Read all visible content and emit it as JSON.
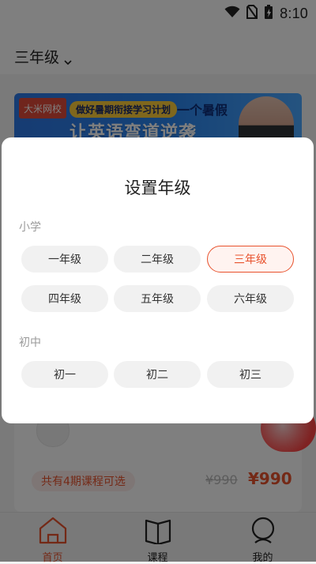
{
  "status_bar": {
    "time": "8:10",
    "icons": [
      "wifi-icon",
      "no-sim-icon",
      "battery-charging-icon"
    ]
  },
  "header": {
    "grade_label": "三年级",
    "dropdown_icon": "chevron-down-icon"
  },
  "banner": {
    "logo_text": "大米网校",
    "tag_text": "做好暑期衔接学习计划",
    "right_text": "一个暑假",
    "title_text": "让英语弯道逆袭"
  },
  "course_card": {
    "periods_text": "共有4期课程可选",
    "price_original": "¥990",
    "price_current": "¥990"
  },
  "dialog": {
    "title": "设置年级",
    "sections": [
      {
        "label": "小学",
        "options": [
          "一年级",
          "二年级",
          "三年级",
          "四年级",
          "五年级",
          "六年级"
        ]
      },
      {
        "label": "初中",
        "options": [
          "初一",
          "初二",
          "初三"
        ]
      }
    ],
    "selected": "三年级"
  },
  "tabbar": {
    "items": [
      {
        "label": "首页",
        "icon": "home-icon",
        "active": true
      },
      {
        "label": "课程",
        "icon": "book-icon",
        "active": false
      },
      {
        "label": "我的",
        "icon": "profile-icon",
        "active": false
      }
    ]
  },
  "colors": {
    "accent": "#e8522d",
    "overlay": "#00000080"
  }
}
